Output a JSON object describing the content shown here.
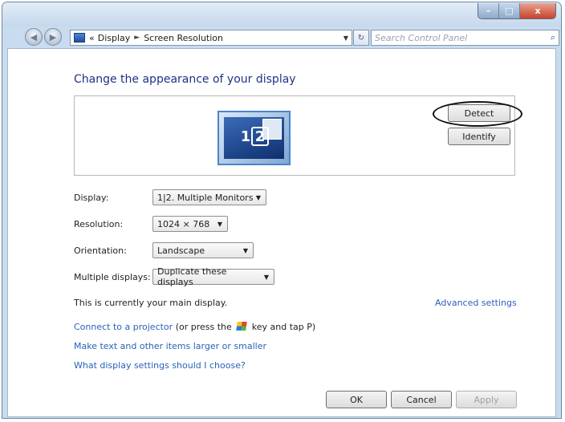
{
  "window": {
    "breadcrumb": {
      "overflow": "«",
      "item1": "Display",
      "separator": "►",
      "item2": "Screen Resolution"
    },
    "search_placeholder": "Search Control Panel",
    "controls": {
      "minimize": "–",
      "maximize": "□",
      "close": "x"
    }
  },
  "heading": "Change the appearance of your display",
  "preview": {
    "monitor_num1": "1",
    "monitor_num2": "2",
    "detect_label": "Detect",
    "identify_label": "Identify"
  },
  "fields": {
    "display": {
      "label": "Display:",
      "value": "1|2. Multiple Monitors"
    },
    "resolution": {
      "label": "Resolution:",
      "value": "1024 × 768"
    },
    "orientation": {
      "label": "Orientation:",
      "value": "Landscape"
    },
    "multiple": {
      "label": "Multiple displays:",
      "value": "Duplicate these displays"
    }
  },
  "main_display_text": "This is currently your main display.",
  "advanced_settings": "Advanced settings",
  "projector": {
    "link": "Connect to a projector",
    "text_before": "(or press the",
    "text_after": "key and tap P)"
  },
  "links": {
    "larger_text": "Make text and other items larger or smaller",
    "settings_help": "What display settings should I choose?"
  },
  "buttons": {
    "ok": "OK",
    "cancel": "Cancel",
    "apply": "Apply"
  },
  "colors": {
    "link": "#2a62b8",
    "heading": "#1e3287",
    "window_frame": "#c9dbee",
    "close_button": "#c8432b"
  }
}
